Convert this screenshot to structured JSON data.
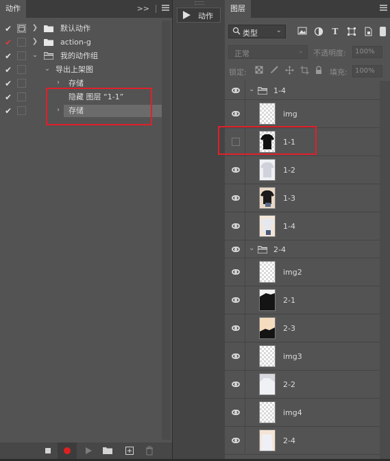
{
  "actions_panel": {
    "tab_label": "动作",
    "tab_tools": ">>",
    "rows": [
      {
        "label": "默认动作",
        "check_color": "white"
      },
      {
        "label": "action-g",
        "check_color": "red"
      },
      {
        "label": "我的动作组",
        "check_color": "white"
      },
      {
        "label": "导出上架图",
        "check_color": "white"
      },
      {
        "label": "存储",
        "check_color": "white"
      },
      {
        "label": "隐藏 图层 “1-1”",
        "check_color": "white"
      },
      {
        "label": "存储",
        "check_color": "white"
      }
    ]
  },
  "middle_strip": {
    "play_label": "动作"
  },
  "layers_panel": {
    "tab_label": "图层",
    "filter_kind": "类型",
    "blend_mode": "正常",
    "opacity_label": "不透明度:",
    "opacity_value": "100%",
    "lock_label": "锁定:",
    "fill_label": "填充:",
    "fill_value": "100%",
    "groups": [
      {
        "name": "1-4"
      },
      {
        "name": "2-4"
      }
    ],
    "layers": [
      {
        "name": "img",
        "visible": true
      },
      {
        "name": "1-1",
        "visible": false
      },
      {
        "name": "1-2",
        "visible": true
      },
      {
        "name": "1-3",
        "visible": true
      },
      {
        "name": "1-4",
        "visible": true
      },
      {
        "name": "img2",
        "visible": true
      },
      {
        "name": "2-1",
        "visible": true
      },
      {
        "name": "2-3",
        "visible": true
      },
      {
        "name": "img3",
        "visible": true
      },
      {
        "name": "2-2",
        "visible": true
      },
      {
        "name": "img4",
        "visible": true
      },
      {
        "name": "2-4",
        "visible": true
      }
    ]
  },
  "colors": {
    "accent_red": "#e0202a",
    "panel_bg": "#535353",
    "frame_bg": "#2b2b2b"
  }
}
